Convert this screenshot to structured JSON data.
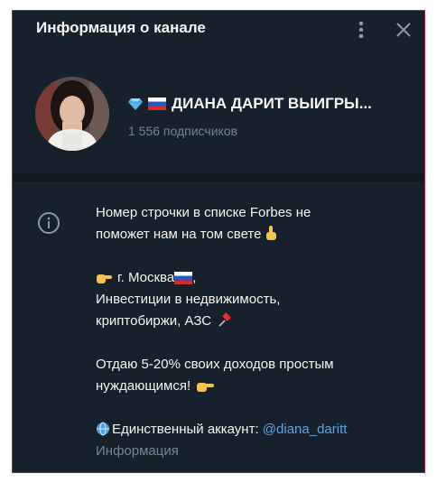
{
  "header": {
    "title": "Информация о канале"
  },
  "channel": {
    "name": "ДИАНА ДАРИТ ВЫИГРЫ...",
    "subscribers": "1 556 подписчиков"
  },
  "about": {
    "p1_line1": "Номер строчки в списке Forbes не",
    "p1_line2": "поможет нам на том свете",
    "p2_line1": "г. Москва",
    "p2_line1_suffix": ",",
    "p2_line2": "Инвестиции в недвижимость,",
    "p2_line3": "криптобиржи, АЗС",
    "p3_line1": "Отдаю 5-20% своих доходов простым",
    "p3_line2": "нуждающимся!",
    "account_prefix": "Единственный аккаунт: ",
    "account_link": "@diana_daritt",
    "label": "Информация"
  },
  "icons": {
    "more": "more-vertical-icon",
    "close": "close-icon",
    "info": "info-icon"
  },
  "colors": {
    "background": "#17212b",
    "text": "#f5f5f5",
    "muted": "#708499",
    "link": "#5aa3e8"
  }
}
